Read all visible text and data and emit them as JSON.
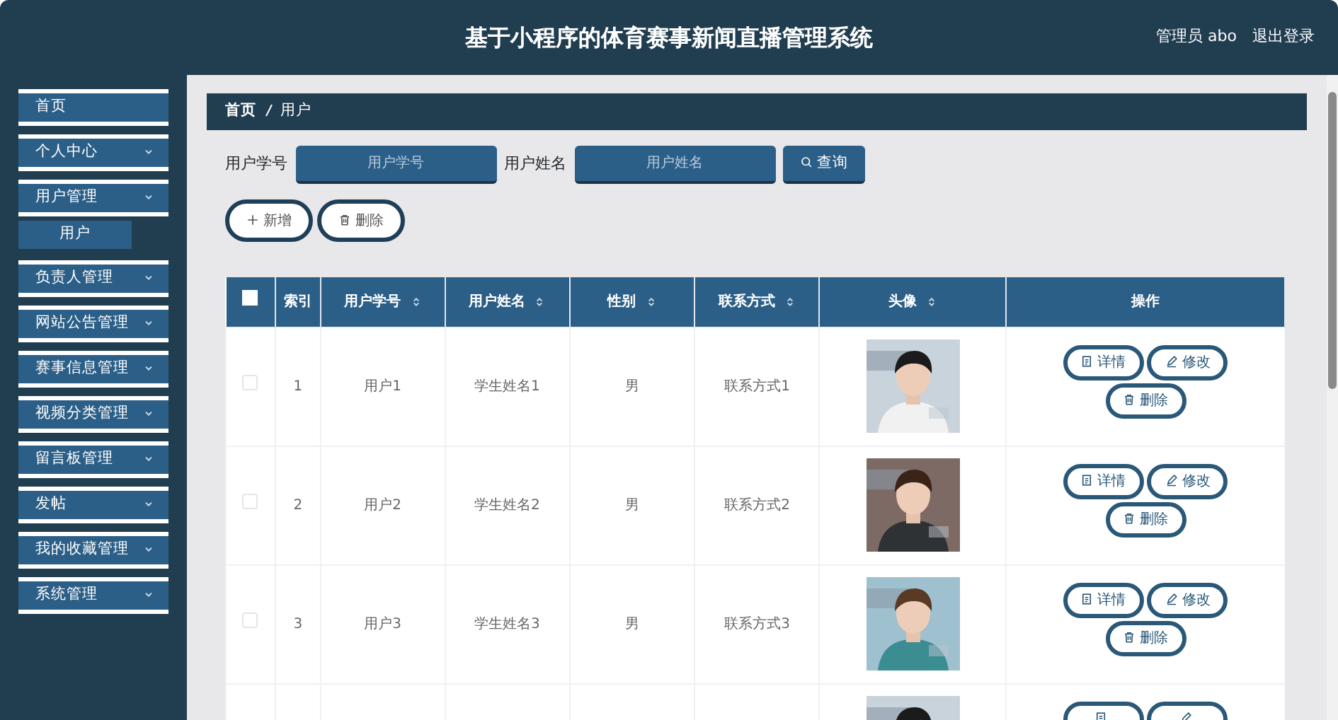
{
  "header": {
    "title": "基于小程序的体育赛事新闻直播管理系统",
    "user": "管理员 abo",
    "logout": "退出登录"
  },
  "sidebar": {
    "items": [
      {
        "label": "首页",
        "kind": "link"
      },
      {
        "label": "个人中心",
        "kind": "menu"
      },
      {
        "label": "用户管理",
        "kind": "menu",
        "children": [
          {
            "label": "用户"
          }
        ]
      },
      {
        "label": "负责人管理",
        "kind": "menu"
      },
      {
        "label": "网站公告管理",
        "kind": "menu"
      },
      {
        "label": "赛事信息管理",
        "kind": "menu"
      },
      {
        "label": "视频分类管理",
        "kind": "menu"
      },
      {
        "label": "留言板管理",
        "kind": "menu"
      },
      {
        "label": "发帖",
        "kind": "menu"
      },
      {
        "label": "我的收藏管理",
        "kind": "menu"
      },
      {
        "label": "系统管理",
        "kind": "menu"
      }
    ]
  },
  "breadcrumb": [
    "首页",
    "用户"
  ],
  "search": {
    "fields": [
      {
        "label": "用户学号",
        "placeholder": "用户学号"
      },
      {
        "label": "用户姓名",
        "placeholder": "用户姓名"
      }
    ],
    "button": "查询"
  },
  "actions": [
    {
      "label": "新增",
      "kind": "add"
    },
    {
      "label": "删除",
      "kind": "delete"
    }
  ],
  "table": {
    "all_checked": false,
    "columns": [
      {
        "label": "索引",
        "sortable": false
      },
      {
        "label": "用户学号",
        "sortable": true
      },
      {
        "label": "用户姓名",
        "sortable": true
      },
      {
        "label": "性别",
        "sortable": true
      },
      {
        "label": "联系方式",
        "sortable": true
      },
      {
        "label": "头像",
        "sortable": true
      },
      {
        "label": "操作",
        "sortable": false
      }
    ],
    "rows": [
      {
        "checked": false,
        "cells": [
          "1",
          "用户1",
          "学生姓名1",
          "男",
          "联系方式1"
        ],
        "avatar": {
          "kind": "picture"
        },
        "buttons": [
          {
            "label": "详情",
            "kind": "detail"
          },
          {
            "label": "修改",
            "kind": "edit"
          },
          {
            "label": "删除",
            "kind": "delete"
          }
        ]
      },
      {
        "checked": false,
        "cells": [
          "2",
          "用户2",
          "学生姓名2",
          "男",
          "联系方式2"
        ],
        "avatar": {
          "kind": "picture"
        },
        "buttons": [
          {
            "label": "详情",
            "kind": "detail"
          },
          {
            "label": "修改",
            "kind": "edit"
          },
          {
            "label": "删除",
            "kind": "delete"
          }
        ]
      },
      {
        "checked": false,
        "cells": [
          "3",
          "用户3",
          "学生姓名3",
          "男",
          "联系方式3"
        ],
        "avatar": {
          "kind": "picture"
        },
        "buttons": [
          {
            "label": "详情",
            "kind": "detail"
          },
          {
            "label": "修改",
            "kind": "edit"
          },
          {
            "label": "删除",
            "kind": "delete"
          }
        ]
      },
      {
        "avatar": {
          "kind": "picture"
        },
        "buttons": [
          {
            "kind": "detail"
          },
          {
            "kind": "edit"
          }
        ]
      }
    ]
  }
}
